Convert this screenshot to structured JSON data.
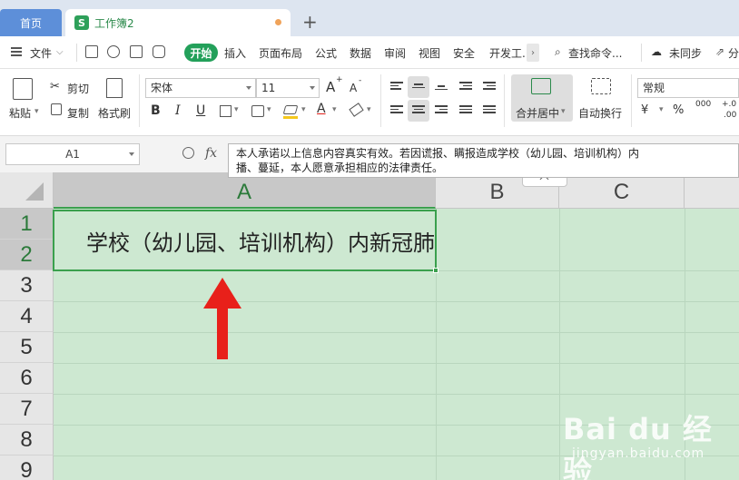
{
  "tabs": {
    "home": "首页",
    "workbook": "工作簿2",
    "workbook_icon": "S",
    "add": "+"
  },
  "menu": {
    "file": "文件",
    "start": "开始",
    "items": [
      "插入",
      "页面布局",
      "公式",
      "数据",
      "审阅",
      "视图",
      "安全",
      "开发工..."
    ],
    "search": "查找命令...",
    "sync": "未同步",
    "share": "分享"
  },
  "ribbon": {
    "paste": "粘贴",
    "cut": "剪切",
    "copy": "复制",
    "format_painter": "格式刷",
    "font_name": "宋体",
    "font_size": "11",
    "font_grow": "A",
    "font_shrink": "A",
    "bold": "B",
    "italic": "I",
    "underline": "U",
    "font_color_glyph": "A",
    "merge_center": "合并居中",
    "wrap_text": "自动换行",
    "number_format": "常规",
    "currency": "¥",
    "percent": "%",
    "thousands": "000",
    "decimal_inc": "+.0",
    "decimal_dec": ".00"
  },
  "formula_bar": {
    "name_box": "A1",
    "fx": "fx",
    "content_line1": "本人承诺以上信息内容真实有效。若因谎报、瞒报造成学校（幼儿园、培训机构）内",
    "content_line2": "播、蔓延，本人愿意承担相应的法律责任。"
  },
  "grid": {
    "columns": [
      "A",
      "B",
      "C"
    ],
    "rows": [
      "1",
      "2",
      "3",
      "4",
      "5",
      "6",
      "7",
      "8",
      "9"
    ],
    "cell_visible_text": "学校（幼儿园、培训机构）内新冠肺"
  },
  "watermark": {
    "brand": "Bai du 经验",
    "url": "jingyan.baidu.com"
  },
  "colors": {
    "accent_green": "#23a05a",
    "grid_fill": "#cde8d1",
    "arrow": "#e8201a",
    "home_tab": "#5d8fd9"
  }
}
